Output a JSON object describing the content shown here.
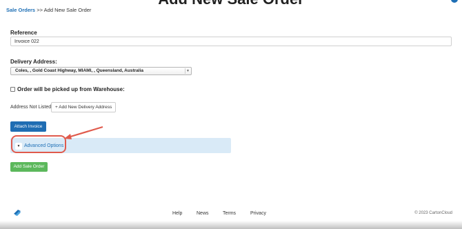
{
  "header": {
    "title": "Add New Sale Order"
  },
  "breadcrumb": {
    "root": "Sale Orders",
    "separator": ">>",
    "current": "Add New Sale Order"
  },
  "form": {
    "reference_label": "Reference",
    "reference_value": "Invoice 022",
    "delivery_label": "Delivery Address:",
    "delivery_value": "Coles, , Gold Coast Highway, MIAMI, , Queensland, Australia",
    "pickup_label": "Order will be picked up from Warehouse:",
    "pickup_checked": false,
    "not_listed_label": "Address Not Listed?",
    "add_address_button": "+ Add New Delivery Address",
    "attach_button": "Attach Invoice",
    "advanced_options": "Advanced Options",
    "submit_button": "Add Sale Order"
  },
  "footer": {
    "links": [
      "Help",
      "News",
      "Terms",
      "Privacy"
    ],
    "copyright": "© 2023 CartonCloud"
  },
  "icons": {
    "add_address": "plus-icon",
    "advanced_toggle": "caret-down-icon",
    "logo": "cartoncloud-logo-icon"
  },
  "colors": {
    "primary": "#1f6db3",
    "success": "#5cb85c",
    "panel": "#d9eaf7",
    "annotation": "#e05a4c"
  }
}
